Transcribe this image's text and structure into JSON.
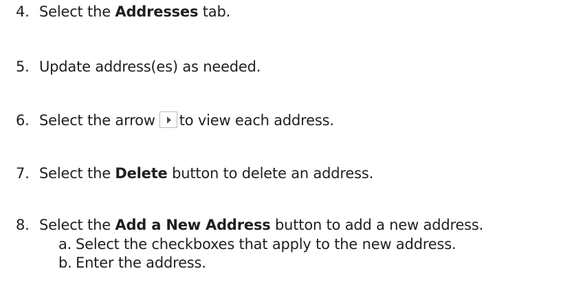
{
  "steps": [
    {
      "number": "4.",
      "pre": "Select the ",
      "bold": "Addresses",
      "post": " tab."
    },
    {
      "number": "5.",
      "text": "Update address(es) as needed."
    },
    {
      "number": "6.",
      "pre": "Select the arrow",
      "post": "to view each address.",
      "icon": "play-arrow-icon"
    },
    {
      "number": "7.",
      "pre": "Select the ",
      "bold": "Delete",
      "post": " button to delete an address."
    },
    {
      "number": "8.",
      "pre": "Select the ",
      "bold": "Add a New Address",
      "post": " button to add a new address."
    }
  ],
  "substeps": [
    {
      "letter": "a.",
      "text": "Select the checkboxes that apply to the new address."
    },
    {
      "letter": "b.",
      "text": "Enter the address."
    }
  ],
  "colors": {
    "text": "#1f1f1f",
    "button_border": "#b8b8b8",
    "arrow": "#4a4a4a"
  }
}
